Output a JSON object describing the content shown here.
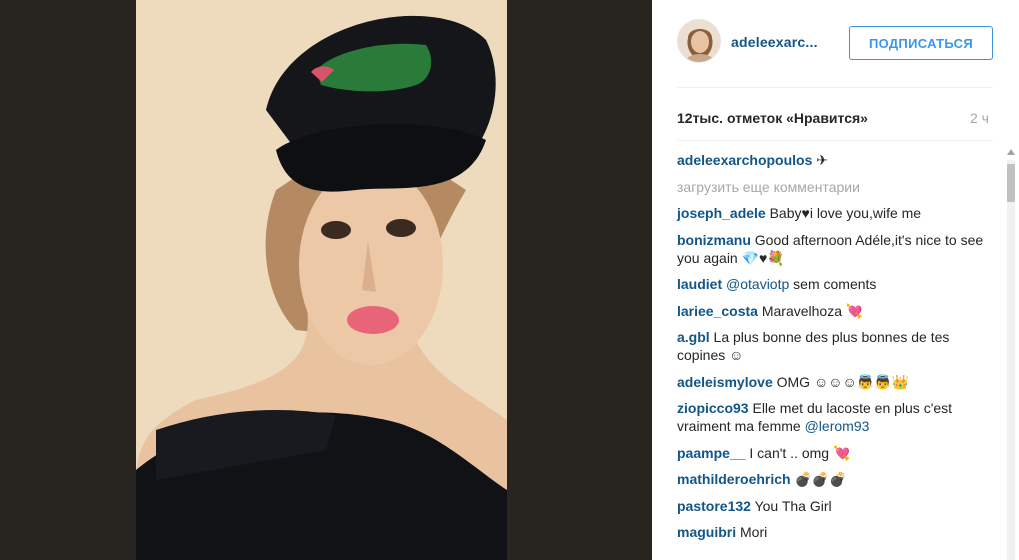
{
  "post": {
    "image_alt": "",
    "username": "adeleexarc...",
    "follow_label": "ПОДПИСАТЬСЯ",
    "likes_text": "12тыс. отметок «Нравится»",
    "time_ago": "2 ч",
    "load_more": "загрузить еще комментарии"
  },
  "comments": [
    {
      "user": "adeleexarchopoulos",
      "text": " ✈"
    },
    {
      "user": "joseph_adele",
      "text": " Baby♥i love you,wife me"
    },
    {
      "user": "bonizmanu",
      "text": " Good afternoon Adéle,it's nice to see you again 💎♥💐"
    },
    {
      "user": "laudiet",
      "mention": " @otaviotp",
      "text": " sem coments"
    },
    {
      "user": "lariee_costa",
      "text": " Maravelhoza 💘"
    },
    {
      "user": "a.gbl",
      "text": " La plus bonne des plus bonnes de tes copines ☺"
    },
    {
      "user": "adeleismylove",
      "text": " OMG ☺☺☺👼👼👑"
    },
    {
      "user": "ziopicco93",
      "text": " Elle met du lacoste en plus c'est vraiment ma femme ",
      "mention_end": "@lerom93"
    },
    {
      "user": "paampe__",
      "text": " I can't .. omg 💘"
    },
    {
      "user": "mathilderoehrich",
      "text": " 💣💣💣"
    },
    {
      "user": "pastore132",
      "text": " You Tha Girl"
    },
    {
      "user": "maguibri",
      "text": " Mori"
    }
  ],
  "colors": {
    "link": "#125688",
    "follow": "#3897f0",
    "muted": "#a5a7aa",
    "text": "#262626"
  },
  "icons": {
    "avatar": "profile-photo",
    "scroll": "scroll-up-arrow"
  }
}
